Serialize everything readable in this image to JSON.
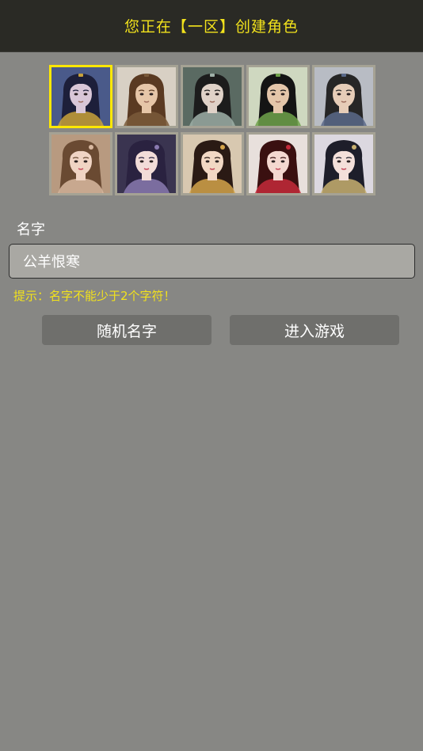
{
  "header": {
    "title": "您正在【一区】创建角色"
  },
  "avatars": [
    {
      "id": "male-1",
      "gender": "male",
      "hair": "#1d1f3a",
      "skin": "#d9c7d8",
      "bg": "#4a5a8a",
      "accent": "#c9a23a",
      "selected": true
    },
    {
      "id": "male-2",
      "gender": "male",
      "hair": "#5a3a22",
      "skin": "#e6c6a8",
      "bg": "#d8d0c4",
      "accent": "#7a5a3a",
      "selected": false
    },
    {
      "id": "male-3",
      "gender": "male",
      "hair": "#1c1c1c",
      "skin": "#e0d2c8",
      "bg": "#5a6a62",
      "accent": "#9fb0a8",
      "selected": false
    },
    {
      "id": "male-4",
      "gender": "male",
      "hair": "#141414",
      "skin": "#e4c6aa",
      "bg": "#cfd8c0",
      "accent": "#6fa24a",
      "selected": false
    },
    {
      "id": "male-5",
      "gender": "male",
      "hair": "#262626",
      "skin": "#e6cdb8",
      "bg": "#b8bcc4",
      "accent": "#5a6a8a",
      "selected": false
    },
    {
      "id": "female-1",
      "gender": "female",
      "hair": "#6a4a32",
      "skin": "#f0d4c4",
      "bg": "#b89a80",
      "accent": "#d8b8a0",
      "selected": false
    },
    {
      "id": "female-2",
      "gender": "female",
      "hair": "#2a2240",
      "skin": "#f2dcd8",
      "bg": "#3a3450",
      "accent": "#8a7ab0",
      "selected": false
    },
    {
      "id": "female-3",
      "gender": "female",
      "hair": "#2a1a14",
      "skin": "#f2d8c4",
      "bg": "#d8c8b0",
      "accent": "#d4a44a",
      "selected": false
    },
    {
      "id": "female-4",
      "gender": "female",
      "hair": "#3a1010",
      "skin": "#f4d8d0",
      "bg": "#e8e0dc",
      "accent": "#c42a3a",
      "selected": false
    },
    {
      "id": "female-5",
      "gender": "female",
      "hair": "#1e1e2a",
      "skin": "#f4e0da",
      "bg": "#dcd8e0",
      "accent": "#c8b070",
      "selected": false
    }
  ],
  "form": {
    "name_label": "名字",
    "name_value": "公羊恨寒",
    "hint": "提示：名字不能少于2个字符！"
  },
  "buttons": {
    "random_name": "随机名字",
    "enter_game": "进入游戏"
  },
  "colors": {
    "page_bg": "#878784",
    "header_bg": "#2a2a25",
    "accent_yellow": "#f2e21c",
    "selected_border": "#ffe800",
    "button_bg": "#6f6f6c",
    "input_bg": "#a9a8a3"
  }
}
